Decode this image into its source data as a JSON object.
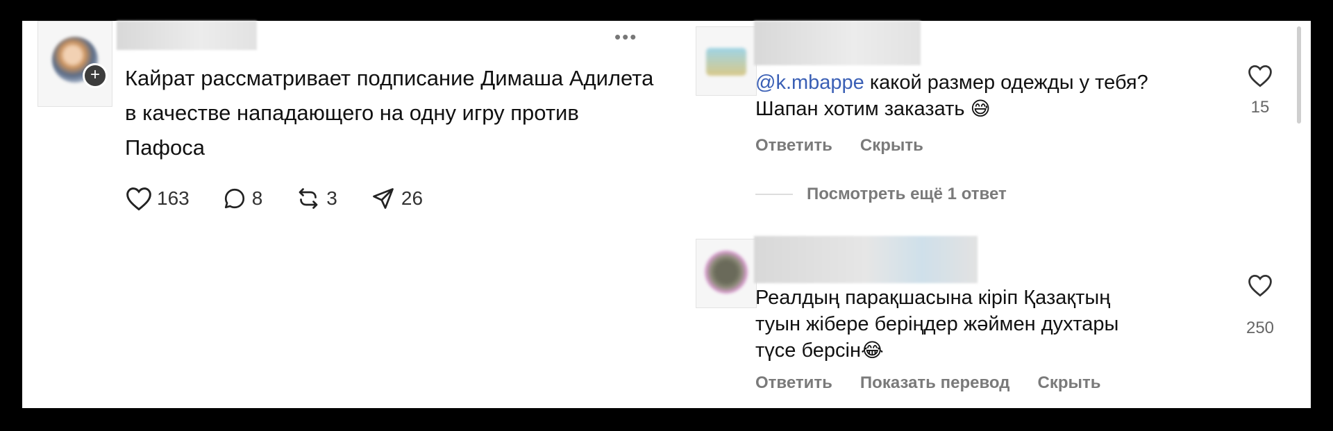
{
  "post": {
    "text": "Кайрат рассматривает подписание Димаша Адилета в качестве нападающего на одну игру против Пафоса",
    "more_icon": "ellipsis-icon",
    "likes": "163",
    "comments": "8",
    "reposts": "3",
    "shares": "26"
  },
  "comments": [
    {
      "mention": "@k.mbappe",
      "text_line1": " какой размер одежды у тебя?",
      "text_line2": "Шапан хотим заказать ",
      "emoji": "😅",
      "likes": "15",
      "reply": "Ответить",
      "hide": "Скрыть",
      "more_replies": "Посмотреть ещё 1 ответ"
    },
    {
      "text": "Реалдың парақшасына кіріп Қазақтың туын жібере беріңдер жәймен духтары түсе берсін",
      "emoji": "😂",
      "likes": "250",
      "reply": "Ответить",
      "translate": "Показать перевод",
      "hide": "Скрыть"
    }
  ],
  "colors": {
    "mention": "#3a5fb5",
    "secondary": "#7a7a7a",
    "background": "#000000"
  }
}
